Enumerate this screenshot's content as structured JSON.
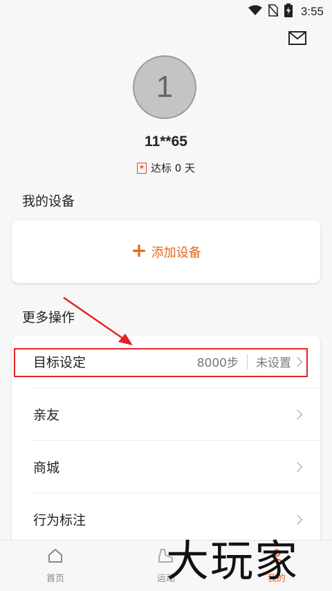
{
  "status_bar": {
    "time": "3:55"
  },
  "profile": {
    "avatar_initial": "1",
    "username": "11**65",
    "achievement_text": "达标 0 天",
    "badge_glyph": "★"
  },
  "my_devices": {
    "title": "我的设备",
    "add_label": "添加设备",
    "add_symbol": "+"
  },
  "more_ops": {
    "title": "更多操作",
    "items": [
      {
        "label": "目标设定",
        "value": "8000步",
        "status": "未设置"
      },
      {
        "label": "亲友"
      },
      {
        "label": "商城"
      },
      {
        "label": "行为标注"
      }
    ]
  },
  "tabs": [
    {
      "label": "首页",
      "icon": "home-icon"
    },
    {
      "label": "运动",
      "icon": "shoe-icon"
    },
    {
      "label": "我的",
      "icon": "person-icon",
      "active": true
    }
  ],
  "watermark": "大玩家",
  "colors": {
    "accent": "#e8661d",
    "annotation_red": "#e52227",
    "background": "#f7f7f7"
  }
}
